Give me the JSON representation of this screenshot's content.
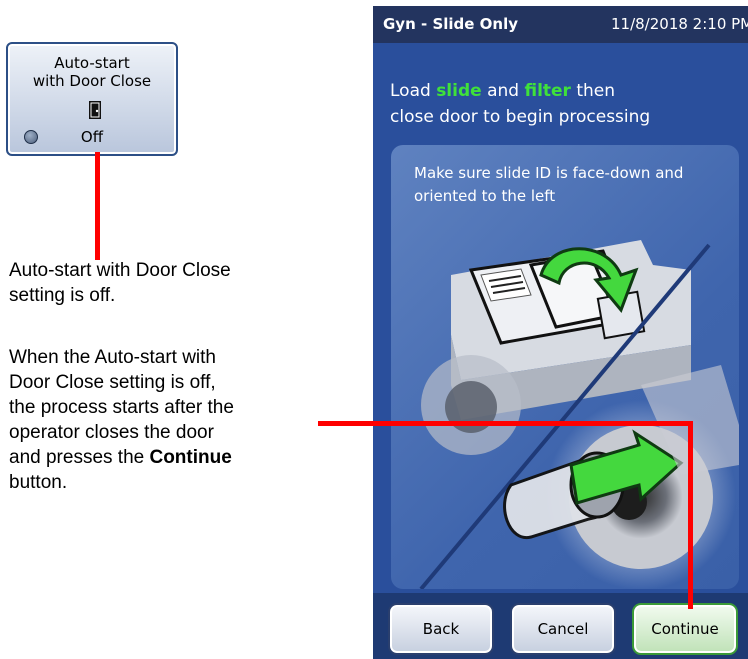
{
  "tile": {
    "title_line1": "Auto-start",
    "title_line2": "with Door Close",
    "icon": "door-icon",
    "status": "Off"
  },
  "annotations": {
    "setting_off_line1": "Auto-start with Door Close",
    "setting_off_line2": "setting is off.",
    "explain_lines": [
      "When the Auto-start with",
      "Door Close setting is off,",
      "the process starts after the",
      "operator closes the door"
    ],
    "explain_prefix": "and presses the ",
    "explain_bold": "Continue",
    "explain_suffix": "button."
  },
  "screen": {
    "header_title": "Gyn - Slide Only",
    "header_datetime": "11/8/2018 2:10 PM",
    "instruction": {
      "part1": "Load ",
      "slide": "slide",
      "part2": " and ",
      "filter": "filter",
      "part3": " then",
      "line2": "close door to begin processing"
    },
    "panel_text": "Make sure slide ID is face-down and oriented to the left",
    "buttons": {
      "back": "Back",
      "cancel": "Cancel",
      "continue": "Continue"
    }
  },
  "colors": {
    "screen_bg": "#2a4f9c",
    "header_bg": "#23345f",
    "highlight": "#3fe13a",
    "callout": "#ff0000"
  }
}
